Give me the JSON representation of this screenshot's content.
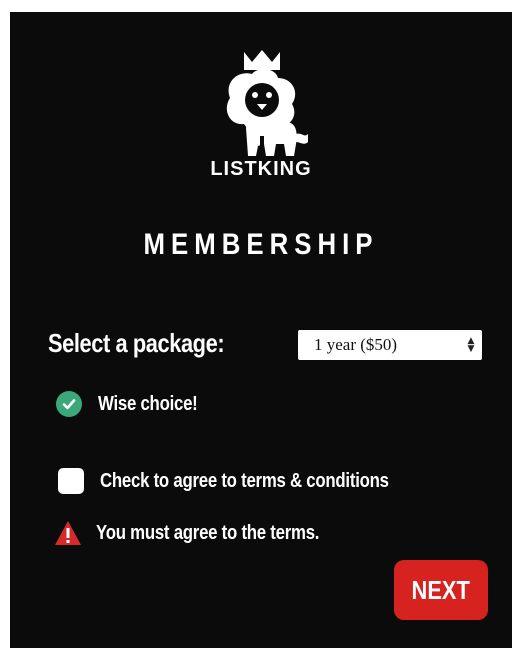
{
  "brand": {
    "name": "LISTKING"
  },
  "page": {
    "title": "MEMBERSHIP"
  },
  "package": {
    "label": "Select a package:",
    "selected": "1 year ($50)"
  },
  "validation": {
    "success_message": "Wise choice!",
    "error_message": "You must agree to the terms."
  },
  "terms": {
    "label": "Check to agree to terms & conditions",
    "checked": false
  },
  "actions": {
    "next_label": "NEXT"
  },
  "colors": {
    "panel_bg": "#0b0b0b",
    "success": "#3aa878",
    "error": "#d62a2a",
    "next_button": "#d7231f",
    "text": "#ffffff"
  },
  "icons": {
    "logo": "lion-with-crown-icon",
    "success": "check-circle-icon",
    "error": "warning-triangle-icon",
    "select": "up-down-chevron-icon"
  }
}
